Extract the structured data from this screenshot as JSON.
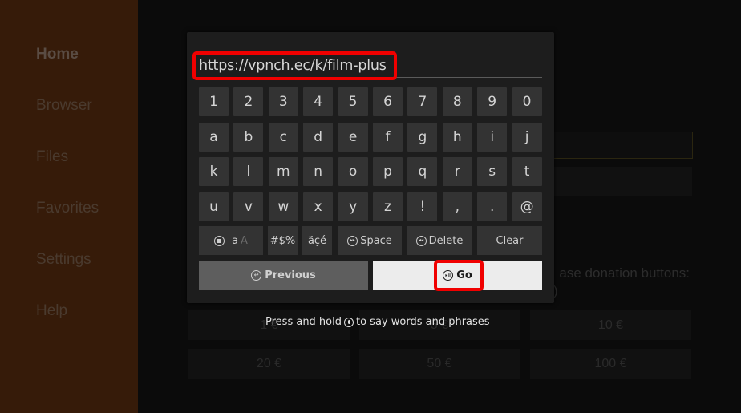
{
  "sidebar": {
    "items": [
      {
        "label": "Home",
        "active": true
      },
      {
        "label": "Browser",
        "active": false
      },
      {
        "label": "Files",
        "active": false
      },
      {
        "label": "Favorites",
        "active": false
      },
      {
        "label": "Settings",
        "active": false
      },
      {
        "label": "Help",
        "active": false
      }
    ]
  },
  "background": {
    "donation_text_line1": "ase donation buttons:",
    "donation_text_line2": ")",
    "donation_buttons": [
      "1 €",
      "5 €",
      "10 €",
      "20 €",
      "50 €",
      "100 €"
    ]
  },
  "keyboard": {
    "url_value": "https://vpnch.ec/k/film-plus",
    "rows": [
      [
        "1",
        "2",
        "3",
        "4",
        "5",
        "6",
        "7",
        "8",
        "9",
        "0"
      ],
      [
        "a",
        "b",
        "c",
        "d",
        "e",
        "f",
        "g",
        "h",
        "i",
        "j"
      ],
      [
        "k",
        "l",
        "m",
        "n",
        "o",
        "p",
        "q",
        "r",
        "s",
        "t"
      ],
      [
        "u",
        "v",
        "w",
        "x",
        "y",
        "z",
        "!",
        ",",
        ".",
        "@"
      ]
    ],
    "function_keys": {
      "case_lower": "a",
      "case_upper": "A",
      "symbols": "#$%",
      "accents": "äçé",
      "space": "Space",
      "delete": "Delete",
      "clear": "Clear"
    },
    "previous_label": "Previous",
    "go_label": "Go",
    "hint_before": "Press and hold",
    "hint_after": "to say words and phrases"
  },
  "colors": {
    "highlight": "#f00000",
    "sidebar_bg": "#361b09",
    "key_bg": "#333333",
    "go_bg": "#ececec"
  }
}
